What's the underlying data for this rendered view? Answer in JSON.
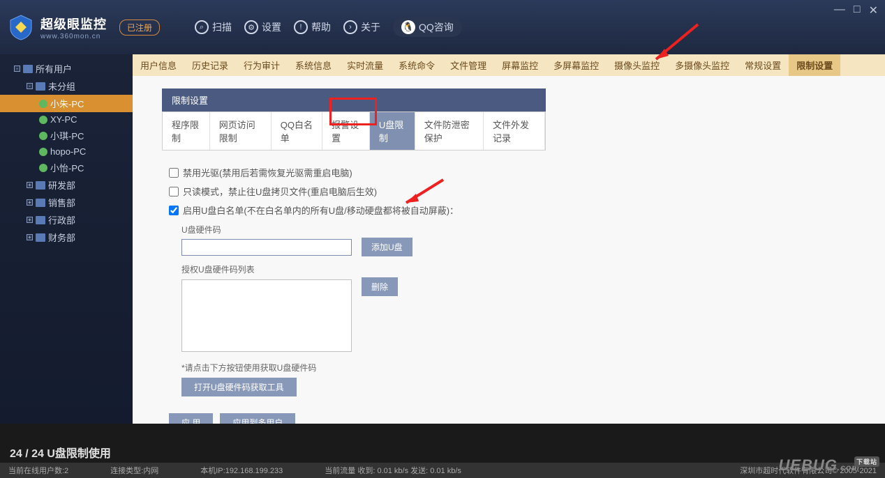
{
  "app": {
    "title_cn": "超级眼监控",
    "title_url": "www.360mon.cn",
    "reg_label": "已注册"
  },
  "top_tools": {
    "scan": "扫描",
    "settings": "设置",
    "help": "帮助",
    "about": "关于",
    "qq": "QQ咨询"
  },
  "win_ctrls": {
    "min": "—",
    "max": "□",
    "close": "✕"
  },
  "sidebar": {
    "root": "所有用户",
    "ungrouped": "未分组",
    "hosts": [
      "小朱-PC",
      "XY-PC",
      "小琪-PC",
      "hopo-PC",
      "小怡-PC"
    ],
    "depts": [
      "研发部",
      "销售部",
      "行政部",
      "财务部"
    ]
  },
  "tabs": [
    "用户信息",
    "历史记录",
    "行为审计",
    "系统信息",
    "实时流量",
    "系统命令",
    "文件管理",
    "屏幕监控",
    "多屏幕监控",
    "摄像头监控",
    "多摄像头监控",
    "常规设置",
    "限制设置"
  ],
  "panel": {
    "title": "限制设置",
    "subtabs": [
      "程序限制",
      "网页访问限制",
      "QQ白名单",
      "报警设置",
      "U盘限制",
      "文件防泄密保护",
      "文件外发记录"
    ],
    "chk1": "禁用光驱(禁用后若需恢复光驱需重启电脑)",
    "chk2": "只读模式，禁止往U盘拷贝文件(重启电脑后生效)",
    "chk3": "启用U盘白名单(不在白名单内的所有U盘/移动硬盘都将被自动屏蔽)：",
    "hw_label": "U盘硬件码",
    "add_btn": "添加U盘",
    "del_btn": "删除",
    "list_label": "授权U盘硬件码列表",
    "hint": "*请点击下方按钮使用获取U盘硬件码",
    "open_tool": "打开U盘硬件码获取工具",
    "apply": "应 用",
    "apply_multi": "应用到多用户"
  },
  "footer": {
    "page_info": "24 / 24   U盘限制使用",
    "online": "当前在线用户数:2",
    "conn": "连接类型:内网",
    "ip": "本机IP:192.168.199.233",
    "traffic": "当前流量 收到: 0.01 kb/s   发送: 0.01 kb/s",
    "copyright": "深圳市超时代软件有限公司© 2005-2021"
  },
  "watermark": {
    "brand": "UEBUG",
    "suffix": ".com",
    "tag": "下载站"
  }
}
